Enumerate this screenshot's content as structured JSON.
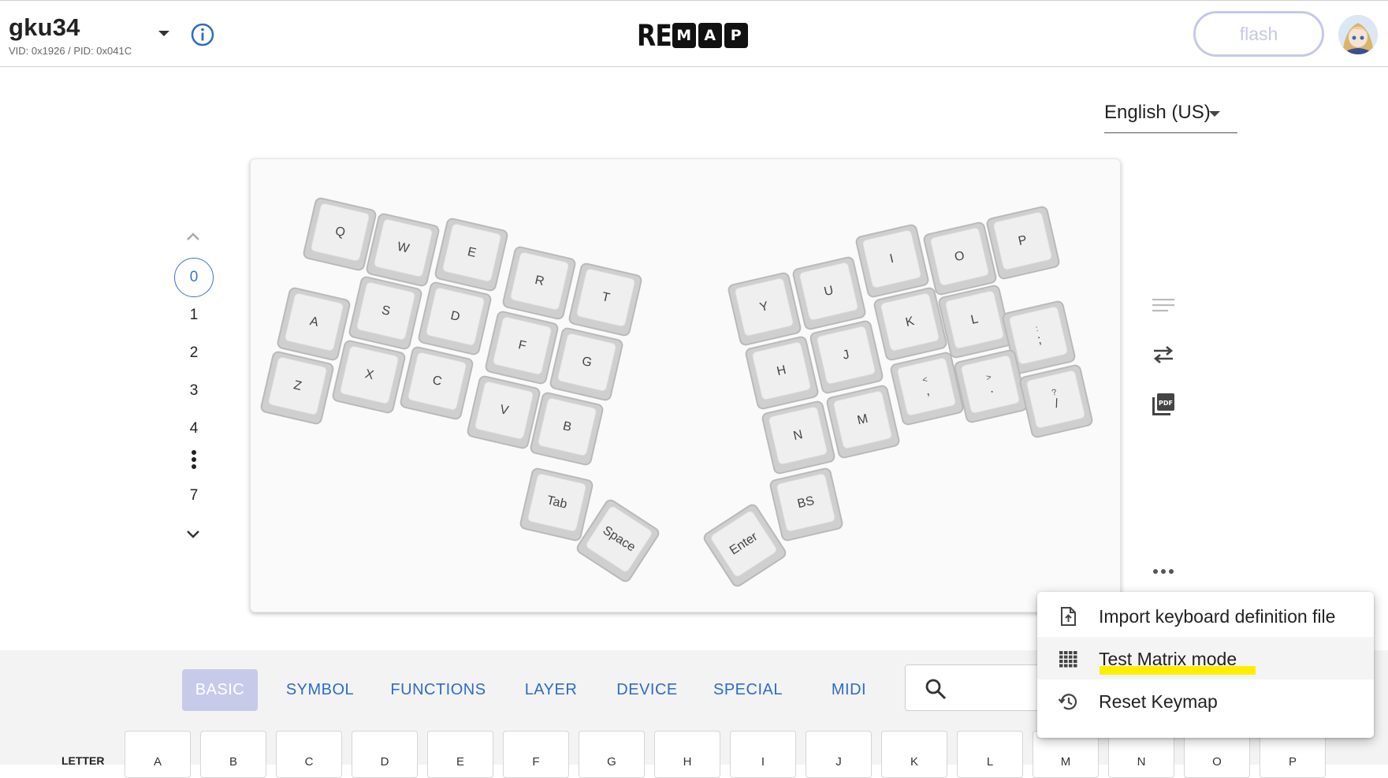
{
  "header": {
    "keyboard_name": "gku34",
    "vid_pid": "VID: 0x1926 / PID: 0x041C",
    "logo": {
      "prefix": "RE",
      "boxed": [
        "M",
        "A",
        "P"
      ]
    },
    "flash_label": "flash"
  },
  "language": {
    "selected": "English (US)"
  },
  "layers": {
    "items": [
      "0",
      "1",
      "2",
      "3",
      "4",
      "7"
    ],
    "selected": "0"
  },
  "keyboard": {
    "keys": [
      {
        "label": "Q"
      },
      {
        "label": "W"
      },
      {
        "label": "E"
      },
      {
        "label": "R"
      },
      {
        "label": "T"
      },
      {
        "label": "A"
      },
      {
        "label": "S"
      },
      {
        "label": "D"
      },
      {
        "label": "F"
      },
      {
        "label": "G"
      },
      {
        "label": "Z"
      },
      {
        "label": "X"
      },
      {
        "label": "C"
      },
      {
        "label": "V"
      },
      {
        "label": "B"
      },
      {
        "label": "Tab"
      },
      {
        "label": "Space"
      },
      {
        "label": "Y"
      },
      {
        "label": "U"
      },
      {
        "label": "I"
      },
      {
        "label": "O"
      },
      {
        "label": "P"
      },
      {
        "label": "H"
      },
      {
        "label": "J"
      },
      {
        "label": "K"
      },
      {
        "label": "L"
      },
      {
        "label": ";",
        "shift": ":"
      },
      {
        "label": "N"
      },
      {
        "label": "M"
      },
      {
        "label": ",",
        "shift": "<"
      },
      {
        "label": ".",
        "shift": ">"
      },
      {
        "label": "/",
        "shift": "?"
      },
      {
        "label": "Enter"
      },
      {
        "label": "BS"
      }
    ]
  },
  "keycode_tabs": [
    "BASIC",
    "SYMBOL",
    "FUNCTIONS",
    "LAYER",
    "DEVICE",
    "SPECIAL",
    "MIDI"
  ],
  "active_tab": "BASIC",
  "keycode_section_label": "LETTER",
  "keycodes": [
    "A",
    "B",
    "C",
    "D",
    "E",
    "F",
    "G",
    "H",
    "I",
    "J",
    "K",
    "L",
    "M",
    "N",
    "O",
    "P"
  ],
  "menu": {
    "items": [
      {
        "label": "Import keyboard definition file",
        "icon": "file-upload-icon"
      },
      {
        "label": "Test Matrix mode",
        "icon": "grid-icon"
      },
      {
        "label": "Reset Keymap",
        "icon": "history-icon"
      }
    ]
  },
  "colors": {
    "accent": "#3f6fd0",
    "tab_text": "#2e6cc4",
    "active_tab_bg": "#c8cae9",
    "flash_border": "#c6c8e8",
    "highlight": "#ffee00"
  }
}
